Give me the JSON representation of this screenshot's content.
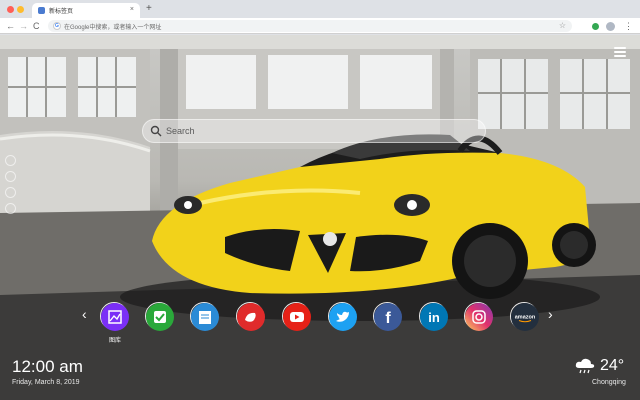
{
  "browser": {
    "tab_title": "新标签页",
    "tab_close": "×",
    "new_tab": "+",
    "back": "←",
    "forward": "→",
    "reload": "C",
    "omnibox_placeholder": "在Google中搜索，或者输入一个网址",
    "star": "☆",
    "menu": "⋮",
    "google_mark": "G",
    "traffic_colors": [
      "#ff5f57",
      "#febc2e",
      "#28c840"
    ]
  },
  "search": {
    "placeholder": "Search"
  },
  "nav_arrows": {
    "prev": "‹",
    "next": "›"
  },
  "apps": [
    {
      "icon": "image-gallery-icon",
      "label": "图库",
      "color": "#7b2ff7"
    },
    {
      "icon": "checkmark-icon",
      "label": "",
      "color": "#2aa83a"
    },
    {
      "icon": "notes-icon",
      "label": "",
      "color": "#2b8bd6"
    },
    {
      "icon": "game-controller-icon",
      "label": "",
      "color": "#e02b2b"
    },
    {
      "icon": "youtube-icon",
      "label": "",
      "color": "#e62117"
    },
    {
      "icon": "twitter-icon",
      "label": "",
      "color": "#1da1f2"
    },
    {
      "icon": "facebook-icon",
      "label": "",
      "color": "#3b5998"
    },
    {
      "icon": "linkedin-icon",
      "label": "",
      "color": "#0077b5"
    },
    {
      "icon": "instagram-icon",
      "label": "",
      "color": "#d6249f"
    },
    {
      "icon": "amazon-icon",
      "label": "",
      "color": "#232f3e"
    }
  ],
  "amazon_text": "amazon",
  "linkedin_text": "in",
  "facebook_text": "f",
  "clock": {
    "time": "12:00 am",
    "date": "Friday, March 8, 2019"
  },
  "weather": {
    "icon": "cloud-rain-icon",
    "temp": "24°",
    "city": "Chongqing"
  }
}
